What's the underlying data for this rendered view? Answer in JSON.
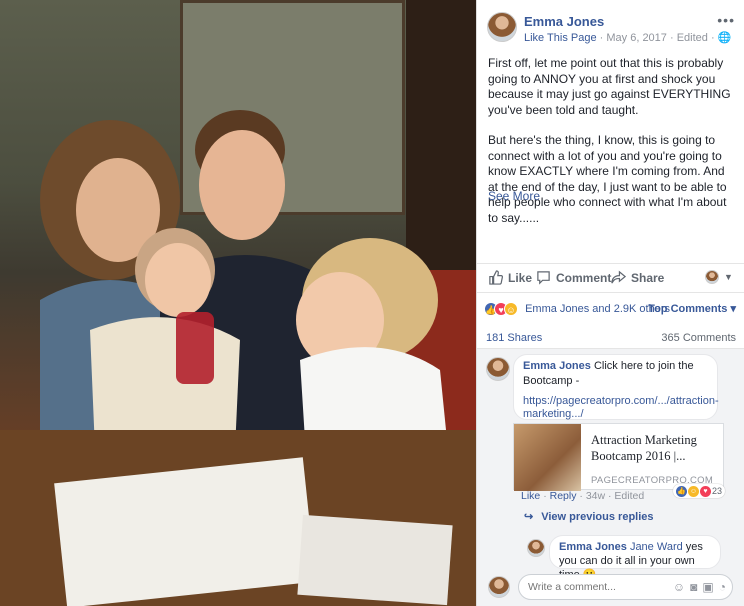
{
  "photo": {
    "alt": ""
  },
  "post": {
    "author": "Emma Jones",
    "like_page": "Like This Page",
    "date": "May 6, 2017",
    "edited": "Edited",
    "more": "•••",
    "para1": "First off, let me point out that this is probably going to ANNOY you at first and shock you because it may just go against EVERYTHING you've been told and taught.",
    "para2": "But here's the thing, I know, this is going to connect with a lot of you and you're going to know EXACTLY where I'm coming from. And at the end of the day, I just want to be able to help people who connect with what I'm about to say......",
    "see_more": "See More"
  },
  "actions": {
    "like": "Like",
    "comment": "Comment",
    "share": "Share"
  },
  "reactions": {
    "text": "Emma Jones and 2.9K others",
    "top_comments": "Top Comments ▾",
    "shares": "181 Shares",
    "comments": "365 Comments",
    "colors": {
      "like": "#4267b2",
      "love": "#f33e58",
      "haha": "#f7b928"
    }
  },
  "comment1": {
    "name": "Emma Jones",
    "text": "Click here to join the Bootcamp -",
    "link": "https://pagecreatorpro.com/.../attraction-marketing.../",
    "preview_title": "Attraction Marketing Bootcamp 2016 |...",
    "preview_domain": "PAGECREATORPRO.COM",
    "like": "Like",
    "reply": "Reply",
    "time": "34w",
    "edited": "Edited",
    "reaction_count": "23"
  },
  "view_previous": "View previous replies",
  "comment2": {
    "name": "Emma Jones",
    "mention": "Jane Ward",
    "text": "yes you can do it all in your own time"
  },
  "comment_box": {
    "placeholder": "Write a comment..."
  }
}
